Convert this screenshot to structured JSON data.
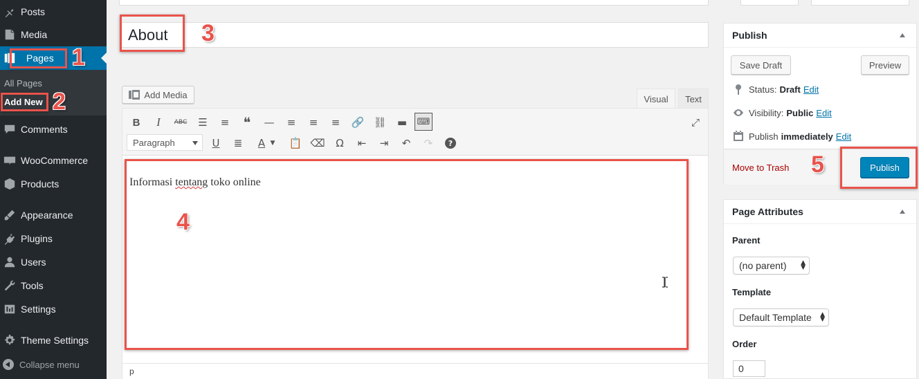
{
  "sidebar": {
    "items": [
      {
        "label": "Posts",
        "icon": "pin-icon"
      },
      {
        "label": "Media",
        "icon": "media-icon"
      },
      {
        "label": "Pages",
        "icon": "pages-icon",
        "active": true
      },
      {
        "label": "Comments",
        "icon": "comment-icon"
      },
      {
        "label": "WooCommerce",
        "icon": "woo-icon"
      },
      {
        "label": "Products",
        "icon": "box-icon"
      },
      {
        "label": "Appearance",
        "icon": "brush-icon"
      },
      {
        "label": "Plugins",
        "icon": "plug-icon"
      },
      {
        "label": "Users",
        "icon": "user-icon"
      },
      {
        "label": "Tools",
        "icon": "wrench-icon"
      },
      {
        "label": "Settings",
        "icon": "settings-icon"
      },
      {
        "label": "Theme Settings",
        "icon": "gear-icon"
      }
    ],
    "submenu": {
      "all_pages": "All Pages",
      "add_new": "Add New"
    },
    "collapse": "Collapse menu"
  },
  "annotations": {
    "n1": "1",
    "n2": "2",
    "n3": "3",
    "n4": "4",
    "n5": "5"
  },
  "editor": {
    "title": "About",
    "add_media": "Add Media",
    "tab_visual": "Visual",
    "tab_text": "Text",
    "format": "Paragraph",
    "content_before": "Informasi ",
    "content_misspelled": "tentang",
    "content_after": " toko online",
    "path": "p"
  },
  "publish": {
    "title": "Publish",
    "save_draft": "Save Draft",
    "preview": "Preview",
    "status_label": "Status:",
    "status_value": "Draft",
    "visibility_label": "Visibility:",
    "visibility_value": "Public",
    "publish_label": "Publish",
    "publish_value": "immediately",
    "edit": "Edit",
    "move_to_trash": "Move to Trash",
    "publish_button": "Publish"
  },
  "page_attributes": {
    "title": "Page Attributes",
    "parent_label": "Parent",
    "parent_value": "(no parent)",
    "template_label": "Template",
    "template_value": "Default Template",
    "order_label": "Order",
    "order_value": "0"
  },
  "colors": {
    "accent": "#0073aa",
    "annotation": "#e9534b",
    "sidebar": "#23282d"
  }
}
